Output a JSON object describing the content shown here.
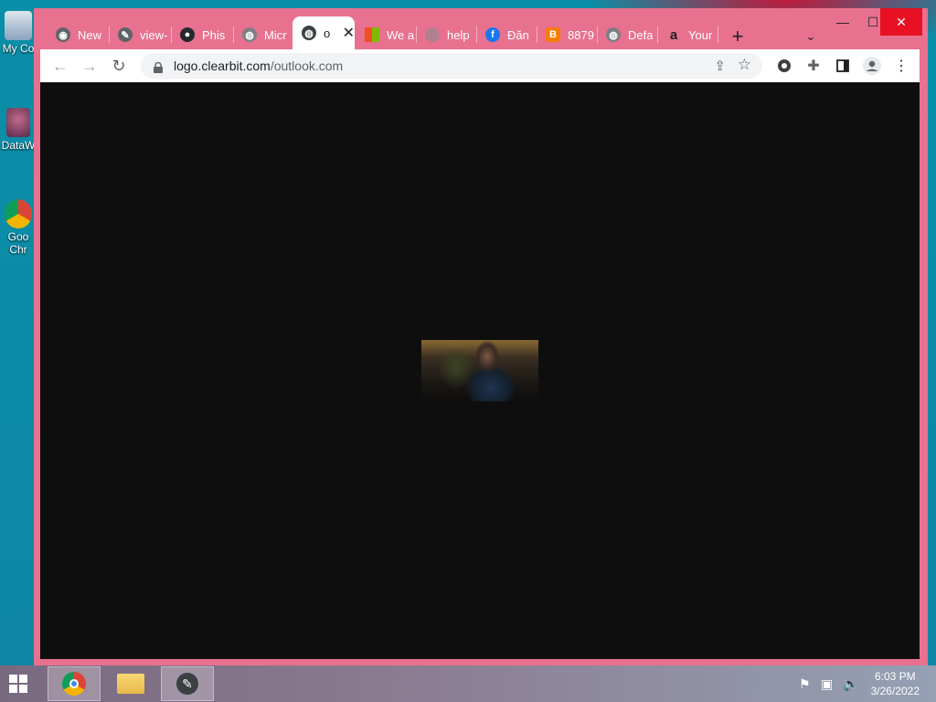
{
  "desktop": {
    "icons": [
      {
        "label": "My Co",
        "icon": "computer-icon"
      },
      {
        "label": "DataW",
        "icon": "shortcut-icon"
      },
      {
        "label": "Goo",
        "label2": "Chr",
        "icon": "chrome-icon"
      }
    ]
  },
  "browser": {
    "tabs": [
      {
        "label": "New",
        "icon": "chrome-icon"
      },
      {
        "label": "view-",
        "icon": "wrench-globe-icon"
      },
      {
        "label": "Phis",
        "icon": "github-icon"
      },
      {
        "label": "Micr",
        "icon": "globe-icon"
      },
      {
        "label": "o",
        "icon": "globe-icon",
        "active": true
      },
      {
        "label": "We a",
        "icon": "microsoft-icon"
      },
      {
        "label": "help",
        "icon": "globe-icon"
      },
      {
        "label": "Đăn",
        "icon": "facebook-icon"
      },
      {
        "label": "8879",
        "icon": "blogger-icon"
      },
      {
        "label": "Defa",
        "icon": "globe-icon"
      },
      {
        "label": "Your",
        "icon": "amazon-icon"
      }
    ],
    "new_tab_label": "+",
    "window_controls": {
      "minimize": "—",
      "maximize": "☐",
      "close": "✕"
    },
    "address": {
      "host": "logo.clearbit.com",
      "path": "/outlook.com"
    },
    "colors": {
      "frame": "#e8718f",
      "content_bg": "#0e0e0e",
      "close_button": "#e81123"
    }
  },
  "taskbar": {
    "apps": [
      "chrome-icon",
      "file-explorer-icon",
      "tool-icon"
    ],
    "time": "6:03 PM",
    "date": "3/26/2022"
  }
}
